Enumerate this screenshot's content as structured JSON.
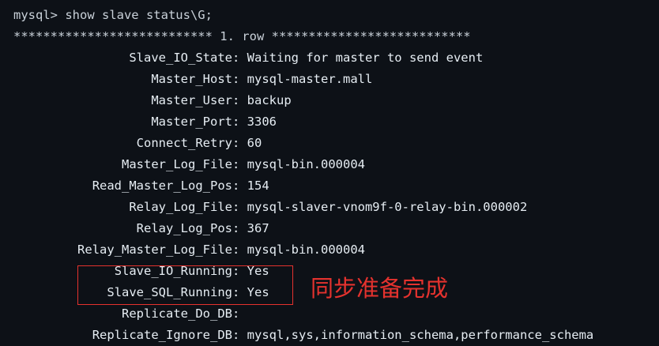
{
  "terminal": {
    "command_line": "mysql> show slave status\\G;",
    "row_header": "*************************** 1. row ***************************",
    "rows": [
      {
        "key": "Slave_IO_State",
        "value": "Waiting for master to send event"
      },
      {
        "key": "Master_Host",
        "value": "mysql-master.mall"
      },
      {
        "key": "Master_User",
        "value": "backup"
      },
      {
        "key": "Master_Port",
        "value": "3306"
      },
      {
        "key": "Connect_Retry",
        "value": "60"
      },
      {
        "key": "Master_Log_File",
        "value": "mysql-bin.000004"
      },
      {
        "key": "Read_Master_Log_Pos",
        "value": "154"
      },
      {
        "key": "Relay_Log_File",
        "value": "mysql-slaver-vnom9f-0-relay-bin.000002"
      },
      {
        "key": "Relay_Log_Pos",
        "value": "367"
      },
      {
        "key": "Relay_Master_Log_File",
        "value": "mysql-bin.000004"
      },
      {
        "key": "Slave_IO_Running",
        "value": "Yes"
      },
      {
        "key": "Slave_SQL_Running",
        "value": "Yes"
      },
      {
        "key": "Replicate_Do_DB",
        "value": ""
      },
      {
        "key": "Replicate_Ignore_DB",
        "value": "mysql,sys,information_schema,performance_schema"
      }
    ]
  },
  "annotation": {
    "text": "同步准备完成",
    "color": "#e5322e"
  }
}
